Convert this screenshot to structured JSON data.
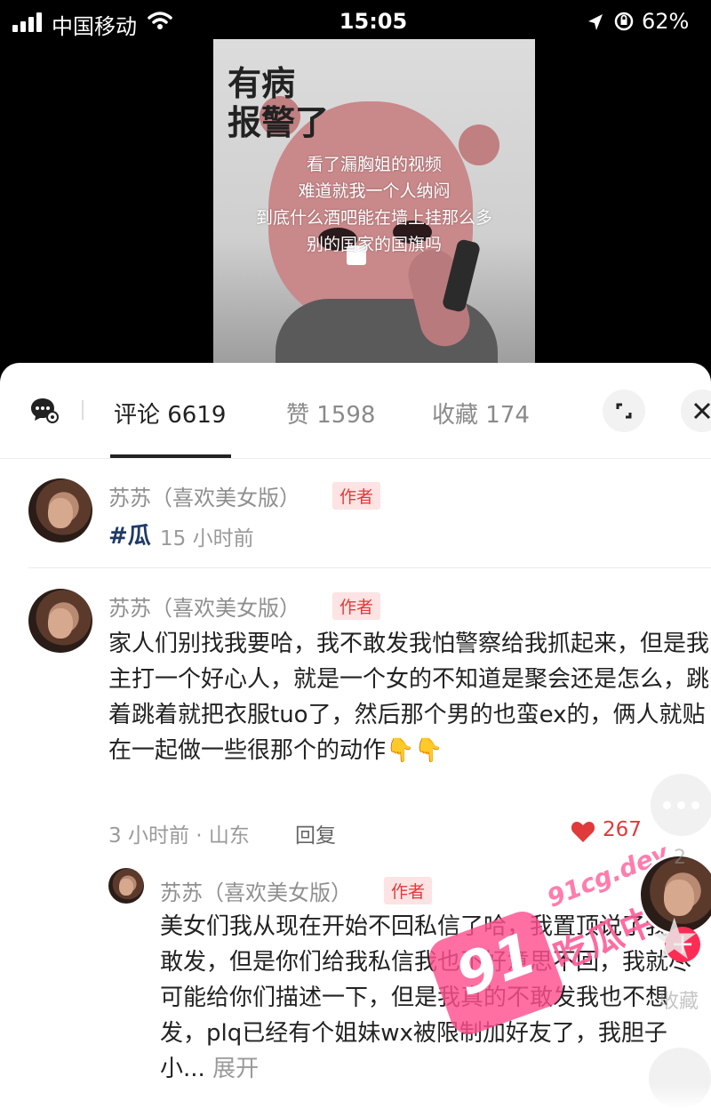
{
  "status_bar": {
    "carrier": "中国移动",
    "time": "15:05",
    "battery": "62%"
  },
  "video": {
    "title_line1": "有病",
    "title_line2": "报警了",
    "lines": [
      "看了漏胸姐的视频",
      "难道就我一个人纳闷",
      "到底什么酒吧能在墙上挂那么多",
      "别的国家的国旗吗"
    ]
  },
  "tabs": [
    {
      "label": "评论 6619"
    },
    {
      "label": "赞 1598"
    },
    {
      "label": "收藏 174"
    }
  ],
  "comments": [
    {
      "user": "苏苏（喜欢美女版）",
      "badge": "作者",
      "hashtag": "#瓜",
      "time": "15 小时前"
    },
    {
      "user": "苏苏（喜欢美女版）",
      "badge": "作者",
      "text": "家人们别找我要哈，我不敢发我怕警察给我抓起来，但是我主打一个好心人，就是一个女的不知道是聚会还是怎么，跳着跳着就把衣服tuo了，然后那个男的也蛮ex的，俩人就贴在一起做一些很那个的动作👇👇",
      "meta": "3 小时前 · 山东",
      "reply_label": "回复",
      "likes": "267"
    },
    {
      "user": "苏苏（喜欢美女版）",
      "badge": "作者",
      "text": "美女们我从现在开始不回私信了哈，我置顶说了我不敢发，但是你们给我私信我也不好意思不回，我就尽可能给你们描述一下，但是我真的不敢发我也不想发，plq已经有个姐妹wx被限制加好友了，我胆子小...",
      "expand": "展开"
    }
  ],
  "watermark": {
    "num": "91",
    "url": "91cg.dev",
    "name": "吃瓜中心"
  },
  "rail": {
    "comment_count": "2",
    "fav_label": "收藏"
  }
}
